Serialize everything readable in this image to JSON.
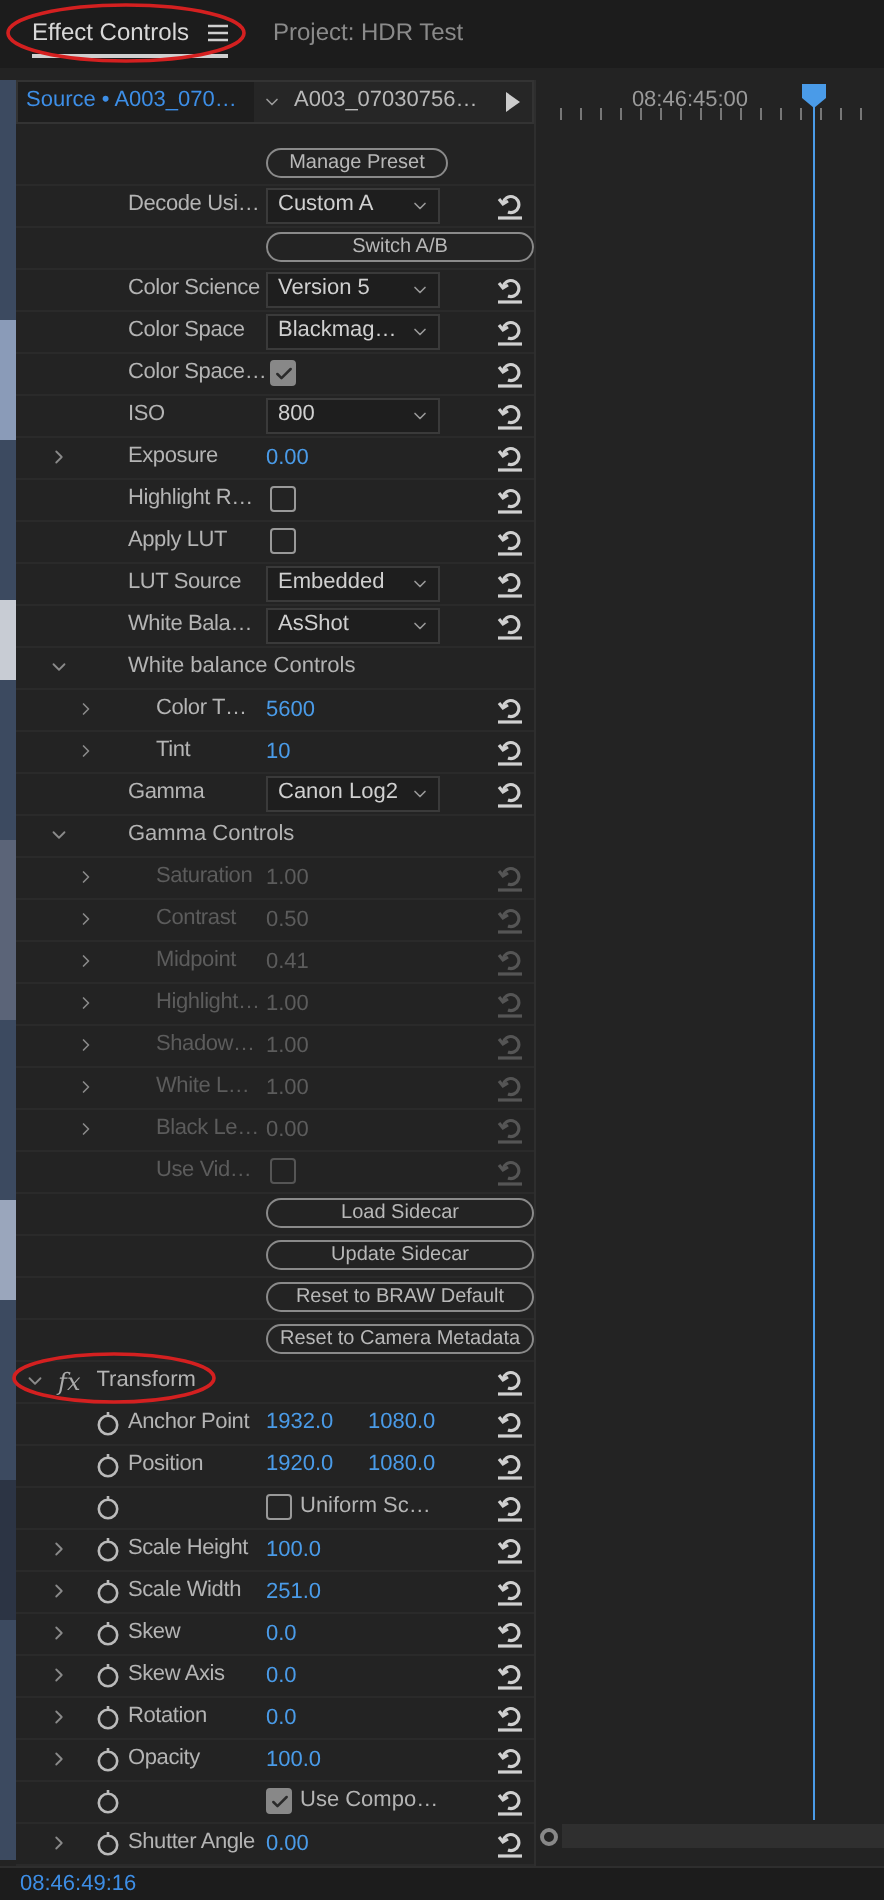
{
  "tabs": [
    {
      "label": "Effect Controls",
      "selected": true,
      "menu": true,
      "circled": true
    },
    {
      "label": "Project: HDR Test",
      "selected": false,
      "menu": false,
      "circled": false
    }
  ],
  "source": {
    "label": "Source • A003_070…",
    "clip": "A003_07030756…"
  },
  "timeline": {
    "ruler_time": "08:46:45:00"
  },
  "rows": [
    {
      "kind": "button",
      "label": "Manage Preset"
    },
    {
      "kind": "dropdown",
      "label": "Decode Usi…",
      "value": "Custom A",
      "reset": true
    },
    {
      "kind": "wide_button",
      "label": "Switch A/B"
    },
    {
      "kind": "dropdown",
      "label": "Color Science",
      "value": "Version 5",
      "reset": true
    },
    {
      "kind": "dropdown",
      "label": "Color Space",
      "value": "Blackmag…",
      "reset": true
    },
    {
      "kind": "checkbox",
      "label": "Color Space…",
      "checked": true,
      "reset": true
    },
    {
      "kind": "dropdown",
      "label": "ISO",
      "value": "800",
      "reset": true
    },
    {
      "kind": "number",
      "label": "Exposure",
      "value": "0.00",
      "expanded": false,
      "reset": true
    },
    {
      "kind": "checkbox",
      "label": "Highlight R…",
      "checked": false,
      "reset": true
    },
    {
      "kind": "checkbox",
      "label": "Apply LUT",
      "checked": false,
      "reset": true
    },
    {
      "kind": "dropdown",
      "label": "LUT Source",
      "value": "Embedded",
      "reset": true
    },
    {
      "kind": "dropdown",
      "label": "White Bala…",
      "value": "AsShot",
      "reset": true
    },
    {
      "kind": "group",
      "label": "White balance Controls",
      "expanded": true,
      "reset": false,
      "children": [
        {
          "kind": "number",
          "label": "Color T…",
          "value": "5600",
          "expanded": false,
          "reset": true
        },
        {
          "kind": "number",
          "label": "Tint",
          "value": "10",
          "expanded": false,
          "reset": true
        }
      ]
    },
    {
      "kind": "dropdown",
      "label": "Gamma",
      "value": "Canon Log2",
      "reset": true
    },
    {
      "kind": "group",
      "label": "Gamma Controls",
      "expanded": true,
      "reset": false,
      "children": [
        {
          "kind": "number",
          "label": "Saturation",
          "value": "1.00",
          "expanded": false,
          "disabled": true,
          "reset": true
        },
        {
          "kind": "number",
          "label": "Contrast",
          "value": "0.50",
          "expanded": false,
          "disabled": true,
          "reset": true
        },
        {
          "kind": "number",
          "label": "Midpoint",
          "value": "0.41",
          "expanded": false,
          "disabled": true,
          "reset": true
        },
        {
          "kind": "number",
          "label": "Highlight…",
          "value": "1.00",
          "expanded": false,
          "disabled": true,
          "reset": true
        },
        {
          "kind": "number",
          "label": "Shadow…",
          "value": "1.00",
          "expanded": false,
          "disabled": true,
          "reset": true
        },
        {
          "kind": "number",
          "label": "White L…",
          "value": "1.00",
          "expanded": false,
          "disabled": true,
          "reset": true
        },
        {
          "kind": "number",
          "label": "Black Le…",
          "value": "0.00",
          "expanded": false,
          "disabled": true,
          "reset": true
        },
        {
          "kind": "checkbox",
          "label": "Use Vid…",
          "checked": false,
          "disabled": true,
          "reset": true
        }
      ]
    },
    {
      "kind": "wide_button",
      "label": "Load Sidecar"
    },
    {
      "kind": "wide_button",
      "label": "Update Sidecar"
    },
    {
      "kind": "wide_button",
      "label": "Reset to BRAW Default"
    },
    {
      "kind": "wide_button",
      "label": "Reset to Camera Metadata"
    },
    {
      "kind": "effect",
      "badge": "fx",
      "label": "Transform",
      "expanded": true,
      "circled": true,
      "reset": true
    },
    {
      "kind": "pair",
      "label": "Anchor Point",
      "values": [
        "1932.0",
        "1080.0"
      ],
      "stopwatch": true,
      "reset": true
    },
    {
      "kind": "pair",
      "label": "Position",
      "values": [
        "1920.0",
        "1080.0"
      ],
      "stopwatch": true,
      "reset": true
    },
    {
      "kind": "check_field",
      "caption": "Uniform Sc…",
      "checked": false,
      "stopwatch": true,
      "reset": true
    },
    {
      "kind": "number",
      "label": "Scale Height",
      "value": "100.0",
      "expanded": false,
      "stopwatch": true,
      "reset": true
    },
    {
      "kind": "number",
      "label": "Scale Width",
      "value": "251.0",
      "expanded": false,
      "stopwatch": true,
      "reset": true
    },
    {
      "kind": "number",
      "label": "Skew",
      "value": "0.0",
      "expanded": false,
      "stopwatch": true,
      "reset": true
    },
    {
      "kind": "number",
      "label": "Skew Axis",
      "value": "0.0",
      "expanded": false,
      "stopwatch": true,
      "reset": true
    },
    {
      "kind": "number",
      "label": "Rotation",
      "value": "0.0",
      "expanded": false,
      "stopwatch": true,
      "reset": true
    },
    {
      "kind": "number",
      "label": "Opacity",
      "value": "100.0",
      "expanded": false,
      "stopwatch": true,
      "reset": true
    },
    {
      "kind": "check_field",
      "caption": "Use Compo…",
      "checked": true,
      "stopwatch": true,
      "reset": true
    },
    {
      "kind": "number",
      "label": "Shutter Angle",
      "value": "0.00",
      "expanded": false,
      "stopwatch": true,
      "reset": true
    }
  ],
  "footer": {
    "timecode": "08:46:49:16"
  }
}
